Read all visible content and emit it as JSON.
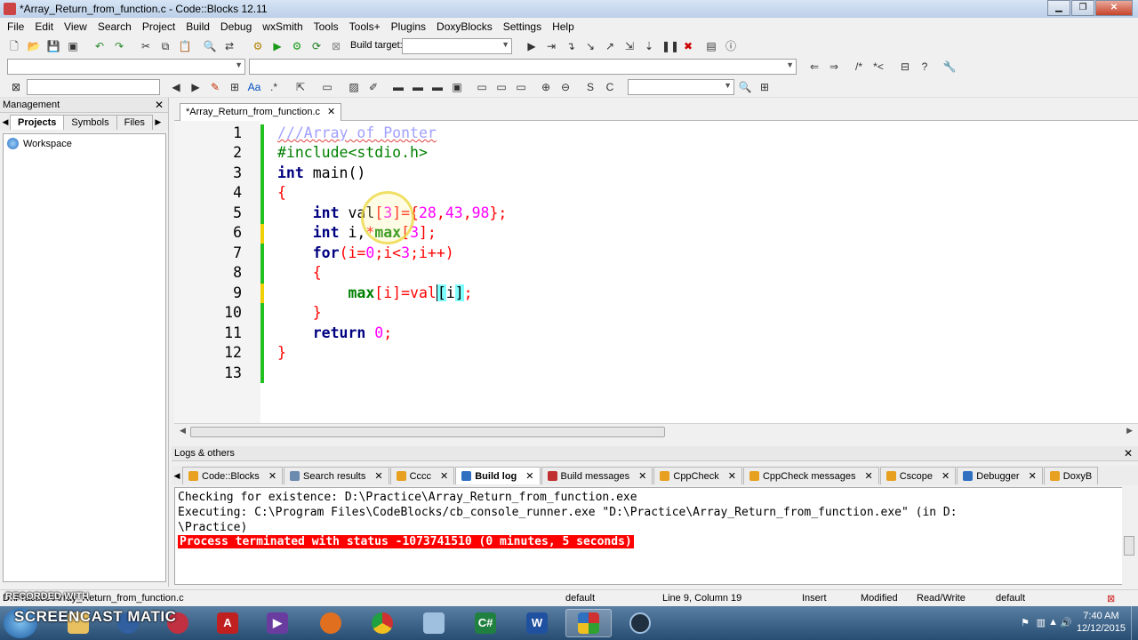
{
  "window": {
    "title": "*Array_Return_from_function.c - Code::Blocks 12.11",
    "minimize": "▁",
    "restore": "❐",
    "close": "✕"
  },
  "menu": [
    "File",
    "Edit",
    "View",
    "Search",
    "Project",
    "Build",
    "Debug",
    "wxSmith",
    "Tools",
    "Tools+",
    "Plugins",
    "DoxyBlocks",
    "Settings",
    "Help"
  ],
  "toolbar": {
    "build_target_label": "Build target:"
  },
  "management": {
    "title": "Management",
    "close": "✕",
    "tabs": [
      "Projects",
      "Symbols",
      "Files"
    ],
    "active_tab": "Projects",
    "workspace_label": "Workspace"
  },
  "editor": {
    "tab_label": "*Array_Return_from_function.c",
    "tab_close": "✕",
    "line_numbers": [
      "1",
      "2",
      "3",
      "4",
      "5",
      "6",
      "7",
      "8",
      "9",
      "10",
      "11",
      "12",
      "13"
    ],
    "lines": {
      "l1": "///Array of Ponter",
      "l2": "#include<stdio.h>",
      "l3_kw": "int",
      "l3_rest": " main()",
      "l4": "{",
      "l5_kw": "int",
      "l5_var": " val",
      "l5_rest1": "[",
      "l5_n1": "3",
      "l5_rest2": "]={",
      "l5_n2": "28",
      "l5_c1": ",",
      "l5_n3": "43",
      "l5_c2": ",",
      "l5_n4": "98",
      "l5_rest3": "};",
      "l6_kw": "int",
      "l6_a": " i,",
      "l6_star": "*",
      "l6_max": "max",
      "l6_b": "[",
      "l6_n": "3",
      "l6_c": "];",
      "l7_kw": "for",
      "l7_a": "(i=",
      "l7_n0": "0",
      "l7_b": ";i<",
      "l7_n3": "3",
      "l7_c": ";i++)",
      "l8": "{",
      "l9_max": "max",
      "l9_a": "[i]=val",
      "l9_b": "[",
      "l9_i": "i",
      "l9_c": "]",
      "l9_d": ";",
      "l10": "}",
      "l11_kw": "return",
      "l11_n": " 0",
      "l11_end": ";",
      "l12": "}"
    }
  },
  "logs": {
    "title": "Logs & others",
    "close": "✕",
    "tabs": [
      {
        "label": "Code::Blocks",
        "close": "✕"
      },
      {
        "label": "Search results",
        "close": "✕"
      },
      {
        "label": "Cccc",
        "close": "✕"
      },
      {
        "label": "Build log",
        "close": "✕"
      },
      {
        "label": "Build messages",
        "close": "✕"
      },
      {
        "label": "CppCheck",
        "close": "✕"
      },
      {
        "label": "CppCheck messages",
        "close": "✕"
      },
      {
        "label": "Cscope",
        "close": "✕"
      },
      {
        "label": "Debugger",
        "close": "✕"
      },
      {
        "label": "DoxyB",
        "close": ""
      }
    ],
    "active_tab": "Build log",
    "lines": [
      "Checking for existence: D:\\Practice\\Array_Return_from_function.exe",
      "Executing: C:\\Program Files\\CodeBlocks/cb_console_runner.exe \"D:\\Practice\\Array_Return_from_function.exe\" (in D:",
      "\\Practice)",
      "Process terminated with status -1073741510 (0 minutes, 5 seconds)"
    ]
  },
  "statusbar": {
    "file": "D:\\Practice\\Array_Return_from_function.c",
    "encoding": "default",
    "position": "Line 9, Column 19",
    "mode": "Insert",
    "modified": "Modified",
    "access": "Read/Write",
    "profile": "default"
  },
  "watermark": {
    "small": "RECORDED WITH",
    "big": "SCREENCAST MATIC"
  },
  "taskbar": {
    "time": "7:40 AM",
    "date": "12/12/2015",
    "tray_arrow": "▲"
  },
  "colors": {
    "keyword": "#000080",
    "number": "#ff00ff",
    "operator": "#ff0000",
    "comment": "#a0a0ff",
    "preprocessor": "#008000",
    "error_bg": "#ff0000"
  }
}
